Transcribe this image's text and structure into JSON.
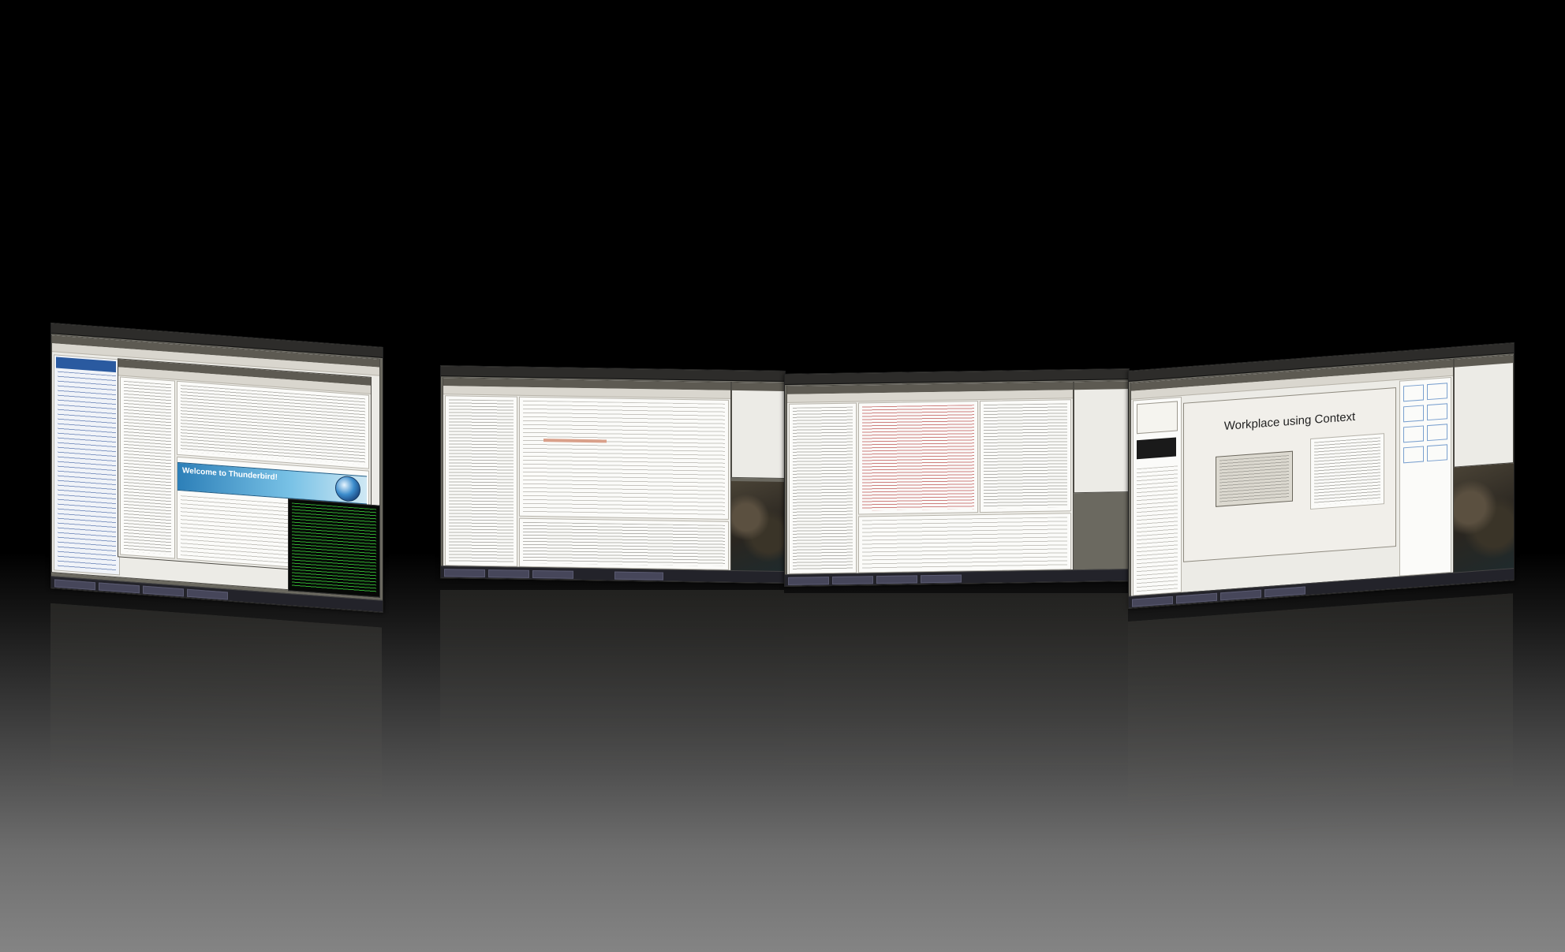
{
  "scene": {
    "type": "3D workspace switcher",
    "workspace_count": 4
  },
  "workspaces": [
    {
      "app": "Thunderbird mail client with terminal",
      "banner_title": "Welcome to Thunderbird!"
    },
    {
      "app": "Code editor / IDE"
    },
    {
      "app": "Code editor with file tree and log output"
    },
    {
      "app": "Presentation editor",
      "slide_title": "Workplace using Context"
    }
  ],
  "icons": {
    "mail_logo": "thunderbird-globe-icon",
    "wallpaper": "rock-wallpaper"
  }
}
